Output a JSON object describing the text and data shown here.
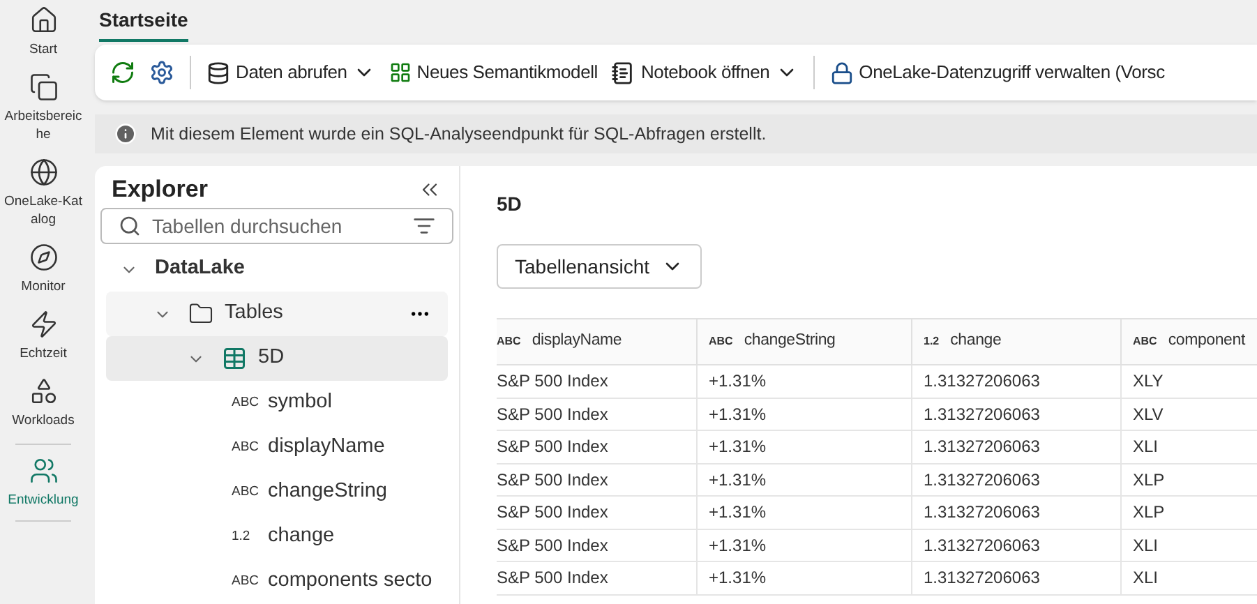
{
  "rail": [
    {
      "kind": "home",
      "label": "Start",
      "selected": false
    },
    {
      "kind": "workspaces",
      "label": "Arbeitsbereiche",
      "selected": false
    },
    {
      "kind": "catalog",
      "label": "OneLake-Katalog",
      "selected": false
    },
    {
      "kind": "monitor",
      "label": "Monitor",
      "selected": false
    },
    {
      "kind": "realtime",
      "label": "Echtzeit",
      "selected": false
    },
    {
      "kind": "workloads",
      "label": "Workloads",
      "selected": false
    },
    {
      "kind": "develop",
      "label": "Entwicklung",
      "selected": true
    }
  ],
  "tabs": [
    {
      "label": "Startseite",
      "selected": true
    }
  ],
  "toolbar": [
    {
      "kind": "refresh"
    },
    {
      "kind": "settings"
    },
    {
      "kind": "separator"
    },
    {
      "kind": "data",
      "label": "Daten abrufen",
      "dropdown": true
    },
    {
      "kind": "model",
      "label": "Neues Semantikmodell",
      "dropdown": false
    },
    {
      "kind": "notebook",
      "label": "Notebook öffnen",
      "dropdown": true
    },
    {
      "kind": "separator"
    },
    {
      "kind": "lock",
      "label": "OneLake-Datenzugriff verwalten (Vorsc",
      "dropdown": false
    }
  ],
  "info_bar": {
    "text": "Mit diesem Element wurde ein SQL-Analyseendpunkt für SQL-Abfragen erstellt."
  },
  "explorer": {
    "title": "Explorer",
    "search": {
      "placeholder": "Tabellen durchsuchen"
    },
    "tree": [
      {
        "label": "DataLake",
        "kind": "root",
        "expanded": true,
        "children": [
          {
            "label": "Tables",
            "kind": "folder",
            "expanded": true,
            "hovered": true,
            "children": [
              {
                "label": "5D",
                "kind": "table",
                "expanded": true,
                "selected": true,
                "children": [
                  {
                    "label": "symbol",
                    "kind": "column",
                    "type": "ABC"
                  },
                  {
                    "label": "displayName",
                    "kind": "column",
                    "type": "ABC"
                  },
                  {
                    "label": "changeString",
                    "kind": "column",
                    "type": "ABC"
                  },
                  {
                    "label": "change",
                    "kind": "column",
                    "type": "1.2"
                  },
                  {
                    "label": "components secto",
                    "kind": "column",
                    "type": "ABC"
                  }
                ]
              }
            ]
          }
        ]
      }
    ]
  },
  "content": {
    "title": "5D",
    "view_button": "Tabellenansicht",
    "table": {
      "columns": [
        {
          "type": "ABC",
          "label": "displayName"
        },
        {
          "type": "ABC",
          "label": "changeString"
        },
        {
          "type": "1.2",
          "label": "change"
        },
        {
          "type": "ABC",
          "label": "component"
        }
      ],
      "rows": [
        [
          "S&P 500 Index",
          "+1.31%",
          "1.31327206063",
          "XLY"
        ],
        [
          "S&P 500 Index",
          "+1.31%",
          "1.31327206063",
          "XLV"
        ],
        [
          "S&P 500 Index",
          "+1.31%",
          "1.31327206063",
          "XLI"
        ],
        [
          "S&P 500 Index",
          "+1.31%",
          "1.31327206063",
          "XLP"
        ],
        [
          "S&P 500 Index",
          "+1.31%",
          "1.31327206063",
          "XLP"
        ],
        [
          "S&P 500 Index",
          "+1.31%",
          "1.31327206063",
          "XLI"
        ],
        [
          "S&P 500 Index",
          "+1.31%",
          "1.31327206063",
          "XLI"
        ]
      ]
    }
  }
}
